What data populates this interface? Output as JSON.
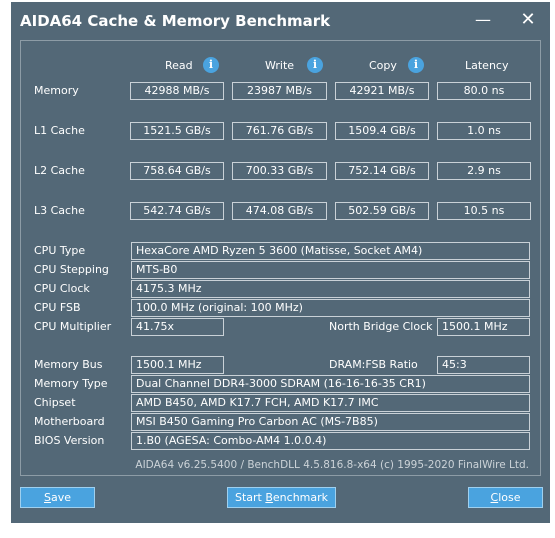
{
  "window": {
    "title": "AIDA64 Cache & Memory Benchmark",
    "min_glyph": "—",
    "close_glyph": "✕"
  },
  "columns": {
    "read": "Read",
    "write": "Write",
    "copy": "Copy",
    "latency": "Latency",
    "info_glyph": "i"
  },
  "rows": {
    "memory": {
      "label": "Memory",
      "read": "42988 MB/s",
      "write": "23987 MB/s",
      "copy": "42921 MB/s",
      "latency": "80.0 ns"
    },
    "l1": {
      "label": "L1 Cache",
      "read": "1521.5 GB/s",
      "write": "761.76 GB/s",
      "copy": "1509.4 GB/s",
      "latency": "1.0 ns"
    },
    "l2": {
      "label": "L2 Cache",
      "read": "758.64 GB/s",
      "write": "700.33 GB/s",
      "copy": "752.14 GB/s",
      "latency": "2.9 ns"
    },
    "l3": {
      "label": "L3 Cache",
      "read": "542.74 GB/s",
      "write": "474.08 GB/s",
      "copy": "502.59 GB/s",
      "latency": "10.5 ns"
    }
  },
  "cpu": {
    "type_label": "CPU Type",
    "type": "HexaCore AMD Ryzen 5 3600  (Matisse, Socket AM4)",
    "stepping_label": "CPU Stepping",
    "stepping": "MTS-B0",
    "clock_label": "CPU Clock",
    "clock": "4175.3 MHz",
    "fsb_label": "CPU FSB",
    "fsb": "100.0 MHz  (original: 100 MHz)",
    "multiplier_label": "CPU Multiplier",
    "multiplier": "41.75x",
    "nb_clock_label": "North Bridge Clock",
    "nb_clock": "1500.1 MHz"
  },
  "system": {
    "bus_label": "Memory Bus",
    "bus": "1500.1 MHz",
    "ratio_label": "DRAM:FSB Ratio",
    "ratio": "45:3",
    "mem_type_label": "Memory Type",
    "mem_type": "Dual Channel DDR4-3000 SDRAM  (16-16-16-35 CR1)",
    "chipset_label": "Chipset",
    "chipset": "AMD B450, AMD K17.7 FCH, AMD K17.7 IMC",
    "motherboard_label": "Motherboard",
    "motherboard": "MSI B450 Gaming Pro Carbon AC (MS-7B85)",
    "bios_label": "BIOS Version",
    "bios": "1.B0  (AGESA: Combo-AM4 1.0.0.4)"
  },
  "footer": "AIDA64 v6.25.5400 / BenchDLL 4.5.816.8-x64  (c) 1995-2020 FinalWire Ltd.",
  "buttons": {
    "save_first": "S",
    "save_rest": "ave",
    "start_pre": "Start ",
    "start_u": "B",
    "start_post": "enchmark",
    "close_first": "C",
    "close_rest": "lose"
  }
}
